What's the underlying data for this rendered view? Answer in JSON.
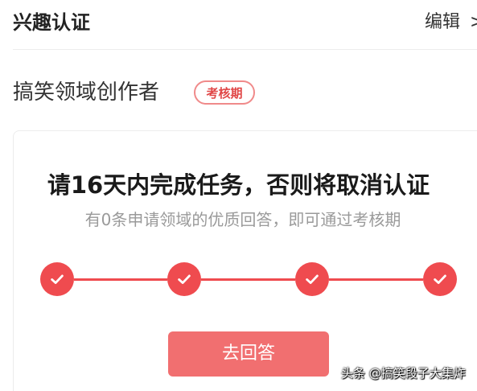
{
  "header": {
    "title": "兴趣认证",
    "edit_label": "编辑",
    "arrow_glyph": ">"
  },
  "section": {
    "title": "搞笑领域创作者",
    "badge": "考核期"
  },
  "task_card": {
    "title": "请16天内完成任务，否则将取消认证",
    "subtitle": "有0条申请领域的优质回答，即可通过考核期",
    "steps": [
      {
        "icon": "check-icon",
        "completed": true
      },
      {
        "icon": "check-icon",
        "completed": true
      },
      {
        "icon": "check-icon",
        "completed": true
      },
      {
        "icon": "check-icon",
        "completed": true
      }
    ],
    "button_label": "去回答"
  },
  "watermark": "头条 @搞笑段子大集炸",
  "colors": {
    "accent": "#ef4b4f",
    "button": "#f16f70",
    "badge_text": "#e04646",
    "muted_text": "#9a9a9a"
  }
}
